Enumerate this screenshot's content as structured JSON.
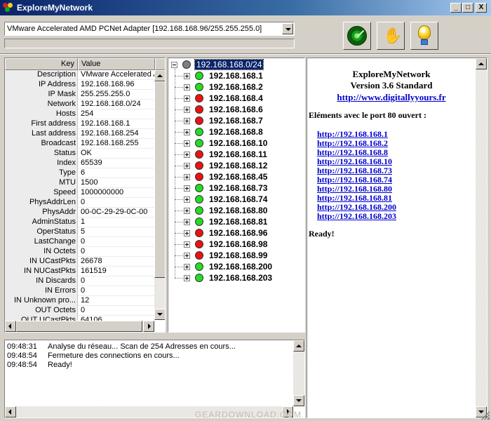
{
  "window": {
    "title": "ExploreMyNetwork",
    "caption_buttons": [
      "_",
      "□",
      "X"
    ]
  },
  "toolbar": {
    "adapter_selected": "VMware Accelerated AMD PCNet Adapter [192.168.168.96/255.255.255.0]",
    "scan_button_icon": "radar-icon",
    "stop_button_icon": "hand-icon",
    "about_button_icon": "lightbulb-icon"
  },
  "grid": {
    "col_key": "Key",
    "col_value": "Value",
    "rows": [
      {
        "key": "Description",
        "value": "VMware Accelerated A"
      },
      {
        "key": "IP Address",
        "value": "192.168.168.96"
      },
      {
        "key": "IP Mask",
        "value": "255.255.255.0"
      },
      {
        "key": "Network",
        "value": "192.168.168.0/24"
      },
      {
        "key": "Hosts",
        "value": "254"
      },
      {
        "key": "First address",
        "value": "192.168.168.1"
      },
      {
        "key": "Last address",
        "value": "192.168.168.254"
      },
      {
        "key": "Broadcast",
        "value": "192.168.168.255"
      },
      {
        "key": "Status",
        "value": "OK"
      },
      {
        "key": "Index",
        "value": "65539"
      },
      {
        "key": "Type",
        "value": "6"
      },
      {
        "key": "MTU",
        "value": "1500"
      },
      {
        "key": "Speed",
        "value": "1000000000"
      },
      {
        "key": "PhysAddrLen",
        "value": "0"
      },
      {
        "key": "PhysAddr",
        "value": "00-0C-29-29-0C-00"
      },
      {
        "key": "AdminStatus",
        "value": "1"
      },
      {
        "key": "OperStatus",
        "value": "5"
      },
      {
        "key": "LastChange",
        "value": "0"
      },
      {
        "key": "IN Octets",
        "value": "0"
      },
      {
        "key": "IN UCastPkts",
        "value": "26678"
      },
      {
        "key": "IN NUCastPkts",
        "value": "161519"
      },
      {
        "key": "IN Discards",
        "value": "0"
      },
      {
        "key": "IN Errors",
        "value": "0"
      },
      {
        "key": "IN Unknown pro...",
        "value": "12"
      },
      {
        "key": "OUT Octets",
        "value": "0"
      },
      {
        "key": "OUT UCastPkts",
        "value": "64106"
      }
    ]
  },
  "tree": {
    "root": "192.168.168.0/24",
    "status_colors": {
      "up": "#22dd22",
      "down": "#ee1111",
      "root": "#808080"
    },
    "hosts": [
      {
        "ip": "192.168.168.1",
        "status": "up"
      },
      {
        "ip": "192.168.168.2",
        "status": "up"
      },
      {
        "ip": "192.168.168.4",
        "status": "down"
      },
      {
        "ip": "192.168.168.6",
        "status": "down"
      },
      {
        "ip": "192.168.168.7",
        "status": "down"
      },
      {
        "ip": "192.168.168.8",
        "status": "up"
      },
      {
        "ip": "192.168.168.10",
        "status": "up"
      },
      {
        "ip": "192.168.168.11",
        "status": "down"
      },
      {
        "ip": "192.168.168.12",
        "status": "down"
      },
      {
        "ip": "192.168.168.45",
        "status": "down"
      },
      {
        "ip": "192.168.168.73",
        "status": "up"
      },
      {
        "ip": "192.168.168.74",
        "status": "up"
      },
      {
        "ip": "192.168.168.80",
        "status": "up"
      },
      {
        "ip": "192.168.168.81",
        "status": "up"
      },
      {
        "ip": "192.168.168.96",
        "status": "down"
      },
      {
        "ip": "192.168.168.98",
        "status": "down"
      },
      {
        "ip": "192.168.168.99",
        "status": "down"
      },
      {
        "ip": "192.168.168.200",
        "status": "up"
      },
      {
        "ip": "192.168.168.203",
        "status": "up"
      }
    ]
  },
  "info": {
    "app_name": "ExploreMyNetwork",
    "version": "Version 3.6 Standard",
    "website": "http://www.digitallyyours.fr",
    "port_heading": "Eléments avec le port 80 ouvert :",
    "port_links": [
      "http://192.168.168.1",
      "http://192.168.168.2",
      "http://192.168.168.8",
      "http://192.168.168.10",
      "http://192.168.168.73",
      "http://192.168.168.74",
      "http://192.168.168.80",
      "http://192.168.168.81",
      "http://192.168.168.200",
      "http://192.168.168.203"
    ],
    "status": "Ready!"
  },
  "log": [
    {
      "time": "09:48:31",
      "msg": "Analyse du réseau... Scan de 254 Adresses en cours..."
    },
    {
      "time": "09:48:54",
      "msg": "Fermeture des connections en cours..."
    },
    {
      "time": "09:48:54",
      "msg": "Ready!"
    }
  ],
  "watermark": "GEARDOWNLOAD.COM"
}
